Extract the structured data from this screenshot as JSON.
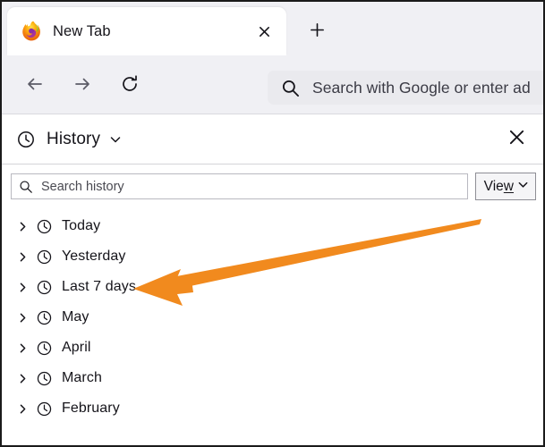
{
  "browser": {
    "tab": {
      "title": "New Tab",
      "favicon_icon": "firefox-logo-icon",
      "close_icon": "close-icon"
    },
    "new_tab_button": {
      "icon": "plus-icon",
      "label": "+"
    },
    "toolbar": {
      "back_icon": "back-arrow-icon",
      "forward_icon": "forward-arrow-icon",
      "reload_icon": "reload-icon",
      "address_bar": {
        "search_icon": "magnifier-icon",
        "placeholder": "Search with Google or enter ad",
        "value": ""
      }
    }
  },
  "history_panel": {
    "header": {
      "clock_icon": "clock-icon",
      "title": "History",
      "dropdown_icon": "chevron-down-icon",
      "close_icon": "close-icon"
    },
    "search": {
      "icon": "magnifier-icon",
      "placeholder": "Search history",
      "value": ""
    },
    "view_button": {
      "label_before": "Vie",
      "label_accel": "w",
      "chevron_icon": "chevron-down-icon"
    },
    "items": [
      {
        "label": "Today",
        "twisty_icon": "chevron-right-icon",
        "clock_icon": "clock-icon"
      },
      {
        "label": "Yesterday",
        "twisty_icon": "chevron-right-icon",
        "clock_icon": "clock-icon"
      },
      {
        "label": "Last 7 days",
        "twisty_icon": "chevron-right-icon",
        "clock_icon": "clock-icon"
      },
      {
        "label": "May",
        "twisty_icon": "chevron-right-icon",
        "clock_icon": "clock-icon"
      },
      {
        "label": "April",
        "twisty_icon": "chevron-right-icon",
        "clock_icon": "clock-icon"
      },
      {
        "label": "March",
        "twisty_icon": "chevron-right-icon",
        "clock_icon": "clock-icon"
      },
      {
        "label": "February",
        "twisty_icon": "chevron-right-icon",
        "clock_icon": "clock-icon"
      }
    ]
  },
  "annotation": {
    "arrow_icon": "annotation-arrow-icon",
    "color": "#F18A1E",
    "points_to": "Last 7 days"
  },
  "colors": {
    "chrome_background": "#F0F0F4",
    "panel_background": "#FFFFFF",
    "text": "#15141A",
    "border": "#D4D4D8",
    "accent_orange": "#F18A1E"
  }
}
